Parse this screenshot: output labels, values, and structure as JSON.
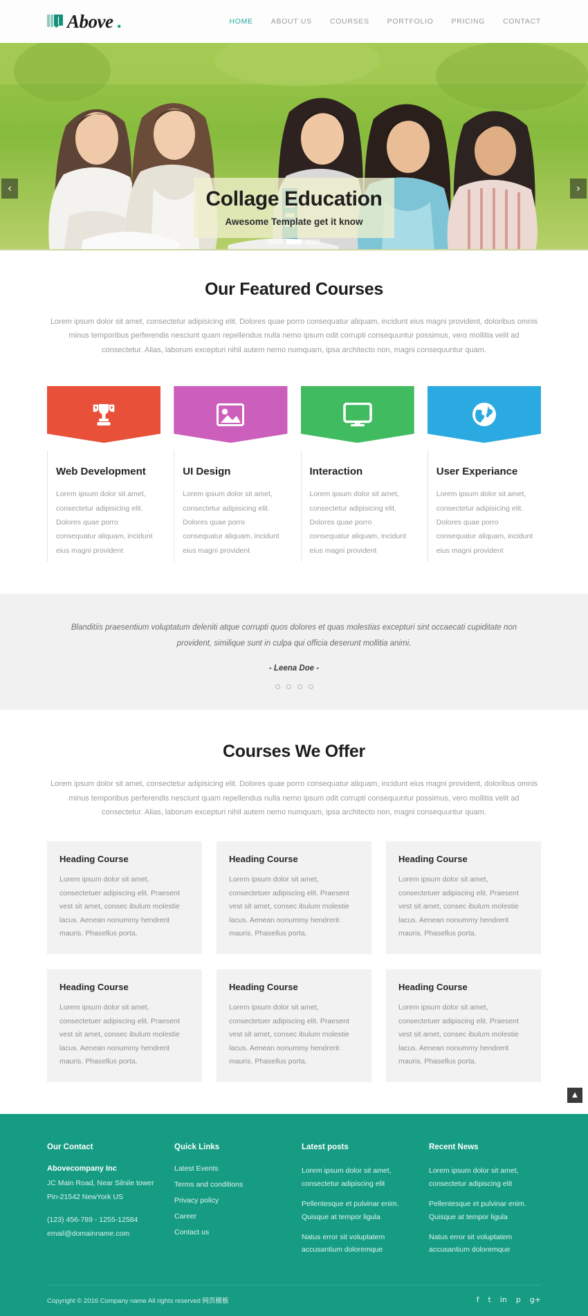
{
  "header": {
    "logo_text": "Above",
    "logo_dot": ".",
    "logo_icon": "book-icon",
    "nav": [
      {
        "label": "HOME",
        "active": true
      },
      {
        "label": "ABOUT US",
        "active": false
      },
      {
        "label": "COURSES",
        "active": false
      },
      {
        "label": "PORTFOLIO",
        "active": false
      },
      {
        "label": "PRICING",
        "active": false
      },
      {
        "label": "CONTACT",
        "active": false
      }
    ]
  },
  "hero": {
    "title": "Collage Education",
    "subtitle": "Awesome Template get it know",
    "prev_icon": "‹",
    "next_icon": "›",
    "slides": 3,
    "active_slide": 2
  },
  "featured": {
    "title": "Our Featured Courses",
    "description": "Lorem ipsum dolor sit amet, consectetur adipisicing elit. Dolores quae porro consequatur aliquam, incidunt eius magni provident, doloribus omnis minus temporibus perferendis nesciunt quam repellendus nulla nemo ipsum odit corrupti consequuntur possimus, vero mollitia velit ad consectetur. Alias, laborum excepturi nihil autem nemo numquam, ipsa architecto non, magni consequuntur quam.",
    "cards": [
      {
        "title": "Web Development",
        "text": "Lorem ipsum dolor sit amet, consectetur adipisicing elit. Dolores quae porro consequatur aliquam, incidunt eius magni provident",
        "color": "#e8503a",
        "icon": "trophy-icon"
      },
      {
        "title": "UI Design",
        "text": "Lorem ipsum dolor sit amet, consectetur adipisicing elit. Dolores quae porro consequatur aliquam, incidunt eius magni provident",
        "color": "#cc5fbb",
        "icon": "image-icon"
      },
      {
        "title": "Interaction",
        "text": "Lorem ipsum dolor sit amet, consectetur adipisicing elit. Dolores quae porro consequatur aliquam, incidunt eius magni provident",
        "color": "#41bb5f",
        "icon": "monitor-icon"
      },
      {
        "title": "User Experiance",
        "text": "Lorem ipsum dolor sit amet, consectetur adipisicing elit. Dolores quae porro consequatur aliquam, incidunt eius magni provident",
        "color": "#2aaae1",
        "icon": "globe-icon"
      }
    ]
  },
  "testimonial": {
    "quote": "Blanditiis praesentium voluptatum deleniti atque corrupti quos dolores et quas molestias excepturi sint occaecati cupiditate non provident, similique sunt in culpa qui officia deserunt mollitia animi.",
    "author": "- Leena Doe -",
    "dots": 4,
    "active_dot": 4
  },
  "offers": {
    "title": "Courses We Offer",
    "description": "Lorem ipsum dolor sit amet, consectetur adipisicing elit. Dolores quae porro consequatur aliquam, incidunt eius magni provident, doloribus omnis minus temporibus perferendis nesciunt quam repellendus nulla nemo ipsum odit corrupti consequuntur possimus, vero mollitia velit ad consectetur. Alias, laborum excepturi nihil autem nemo numquam, ipsa architecto non, magni consequuntur quam.",
    "cards": [
      {
        "title": "Heading Course",
        "text": "Lorem ipsum dolor sit amet, consectetuer adipiscing elit. Praesent vest sit amet, consec ibulum molestie lacus. Aenean nonummy hendrerit mauris. Phasellus porta."
      },
      {
        "title": "Heading Course",
        "text": "Lorem ipsum dolor sit amet, consectetuer adipiscing elit. Praesent vest sit amet, consec ibulum molestie lacus. Aenean nonummy hendrerit mauris. Phasellus porta."
      },
      {
        "title": "Heading Course",
        "text": "Lorem ipsum dolor sit amet, consectetuer adipiscing elit. Praesent vest sit amet, consec ibulum molestie lacus. Aenean nonummy hendrerit mauris. Phasellus porta."
      },
      {
        "title": "Heading Course",
        "text": "Lorem ipsum dolor sit amet, consectetuer adipiscing elit. Praesent vest sit amet, consec ibulum molestie lacus. Aenean nonummy hendrerit mauris. Phasellus porta."
      },
      {
        "title": "Heading Course",
        "text": "Lorem ipsum dolor sit amet, consectetuer adipiscing elit. Praesent vest sit amet, consec ibulum molestie lacus. Aenean nonummy hendrerit mauris. Phasellus porta."
      },
      {
        "title": "Heading Course",
        "text": "Lorem ipsum dolor sit amet, consectetuer adipiscing elit. Praesent vest sit amet, consec ibulum molestie lacus. Aenean nonummy hendrerit mauris. Phasellus porta."
      }
    ]
  },
  "footer": {
    "contact": {
      "heading": "Our Contact",
      "company": "Abovecompany Inc",
      "address1": "JC Main Road, Near Silnile tower",
      "address2": "Pin-21542 NewYork US",
      "phone": "(123) 456-789 - 1255-12584",
      "email": "email@domainname.com"
    },
    "quick_links": {
      "heading": "Quick Links",
      "items": [
        "Latest Events",
        "Terms and conditions",
        "Privacy policy",
        "Career",
        "Contact us"
      ]
    },
    "latest_posts": {
      "heading": "Latest posts",
      "items": [
        "Lorem ipsum dolor sit amet, consectetur adipiscing elit",
        "Pellentesque et pulvinar enim. Quisque at tempor ligula",
        "Natus error sit voluptatem accusantium doloremque"
      ]
    },
    "recent_news": {
      "heading": "Recent News",
      "items": [
        "Lorem ipsum dolor sit amet, consectetur adipiscing elit",
        "Pellentesque et pulvinar enim. Quisque at tempor ligula",
        "Natus error sit voluptatem accusantium doloremque"
      ]
    },
    "copyright": "Copyright © 2016 Company name All rights reserved 网页模板",
    "socials": [
      {
        "name": "facebook-icon",
        "glyph": "f"
      },
      {
        "name": "twitter-icon",
        "glyph": "t"
      },
      {
        "name": "linkedin-icon",
        "glyph": "in"
      },
      {
        "name": "pinterest-icon",
        "glyph": "p"
      },
      {
        "name": "googleplus-icon",
        "glyph": "g+"
      }
    ],
    "to_top_icon": "▲",
    "accent_color": "#169c83"
  }
}
